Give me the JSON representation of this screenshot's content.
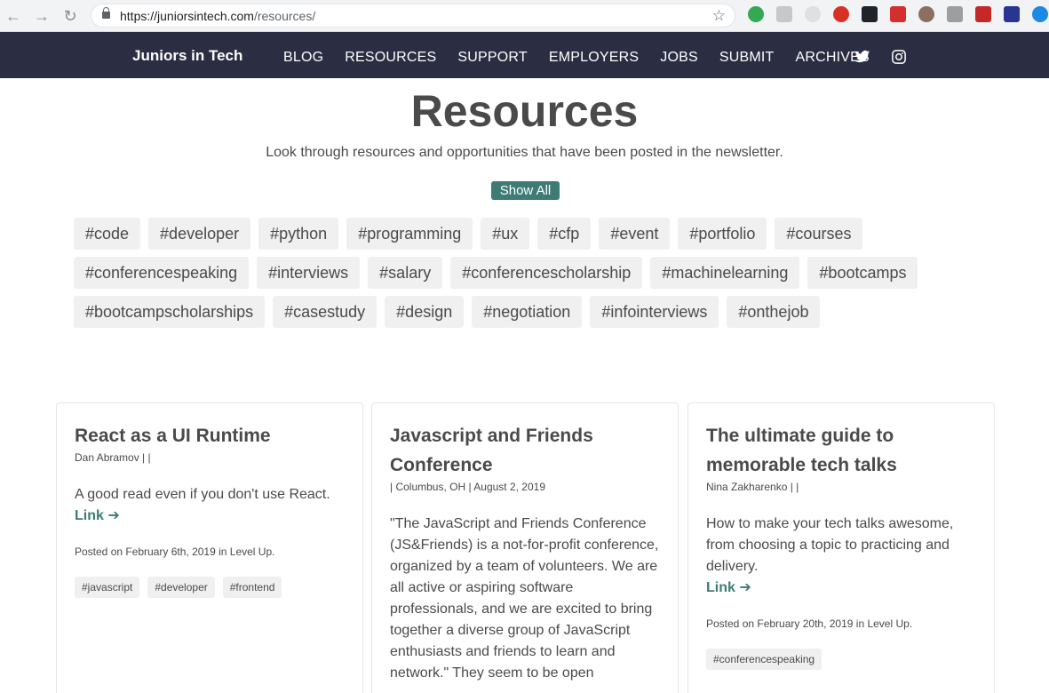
{
  "browser": {
    "url_host": "https://juniorsintech.com",
    "url_path": "/resources/"
  },
  "site": {
    "brand": "Juniors in Tech",
    "menu": [
      "BLOG",
      "RESOURCES",
      "SUPPORT",
      "EMPLOYERS",
      "JOBS",
      "SUBMIT",
      "ARCHIVES"
    ]
  },
  "header": {
    "title": "Resources",
    "subtitle": "Look through resources and opportunities that have been posted in the newsletter.",
    "show_all": "Show All"
  },
  "tag_rows": [
    [
      "#code",
      "#developer",
      "#python",
      "#programming",
      "#ux",
      "#cfp",
      "#event",
      "#portfolio",
      "#courses"
    ],
    [
      "#conferencespeaking",
      "#interviews",
      "#salary",
      "#conferencescholarship",
      "#machinelearning",
      "#bootcamps"
    ],
    [
      "#bootcampscholarships",
      "#casestudy",
      "#design",
      "#negotiation",
      "#infointerviews",
      "#onthejob"
    ]
  ],
  "cards": [
    {
      "title": "React as a UI Runtime",
      "meta": "Dan Abramov | |",
      "description": "A good read even if you don't use React.",
      "link": "Link ➔",
      "posted": "Posted on February 6th, 2019 in Level Up.",
      "tags": [
        "#javascript",
        "#developer",
        "#frontend"
      ]
    },
    {
      "title": "Javascript and Friends Conference",
      "meta": "| Columbus, OH | August 2, 2019",
      "description": "\"The JavaScript and Friends Conference (JS&Friends) is a not-for-profit conference, organized by a team of volunteers. We are all active or aspiring software professionals, and we are excited to bring together a diverse group of JavaScript enthusiasts and friends to learn and network.\" They seem to be open",
      "link": "",
      "posted": "",
      "tags": []
    },
    {
      "title": "The ultimate guide to memorable tech talks",
      "meta": "Nina Zakharenko | |",
      "description": "How to make your tech talks awesome, from choosing a topic to practicing and delivery.",
      "link": "Link ➔",
      "posted": "Posted on February 20th, 2019 in Level Up.",
      "tags": [
        "#conferencespeaking"
      ]
    }
  ],
  "colors": {
    "nav_bg": "#2b2d42",
    "accent": "#3e7b74",
    "tag_bg": "#f0f0f0",
    "text": "#4a4a4a"
  },
  "icons": [
    "back-arrow-icon",
    "forward-arrow-icon",
    "reload-icon",
    "lock-icon",
    "star-icon",
    "twitter-icon",
    "instagram-icon"
  ]
}
